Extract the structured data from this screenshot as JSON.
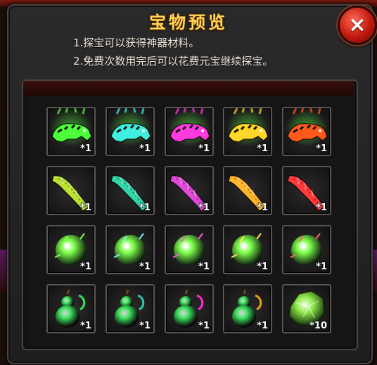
{
  "title": "宝物预览",
  "close_symbol": "×",
  "description": [
    "1.探宝可以获得神器材料。",
    "2.免费次数用完后可以花费元宝继续探宝。"
  ],
  "rows": [
    {
      "type": "tiger-statue-icon",
      "items": [
        {
          "color": "#4dff3a",
          "qty": "*1"
        },
        {
          "color": "#3ff0e0",
          "qty": "*1"
        },
        {
          "color": "#ff3adf",
          "qty": "*1"
        },
        {
          "color": "#ffd72a",
          "qty": "*1"
        },
        {
          "color": "#ff5a1a",
          "qty": "*1"
        }
      ]
    },
    {
      "type": "scroll-ribbon-icon",
      "items": [
        {
          "color": "#b9e233",
          "qty": "*1"
        },
        {
          "color": "#33d4a8",
          "qty": "*1"
        },
        {
          "color": "#e04ad8",
          "qty": "*1"
        },
        {
          "color": "#ffb52a",
          "qty": "*1"
        },
        {
          "color": "#ff3a3a",
          "qty": "*1"
        }
      ]
    },
    {
      "type": "spirit-orb-icon",
      "items": [
        {
          "color": "#7dff4a",
          "qty": "*1"
        },
        {
          "color": "#7ff0ff",
          "qty": "*1"
        },
        {
          "color": "#ff5ae6",
          "qty": "*1"
        },
        {
          "color": "#ffe84a",
          "qty": "*1"
        },
        {
          "color": "#ff6a5a",
          "qty": "*1"
        }
      ]
    },
    {
      "type": "gourd-icon",
      "items": [
        {
          "color": "#39e05a",
          "qty": "*1"
        },
        {
          "color": "#2fc8a8",
          "qty": "*1"
        },
        {
          "color": "#ff2ad0",
          "qty": "*1"
        },
        {
          "color": "#e8a21a",
          "qty": "*1"
        },
        {
          "color": "#8ee84a",
          "qty": "*10",
          "type": "jade-fragment-icon"
        }
      ]
    }
  ]
}
